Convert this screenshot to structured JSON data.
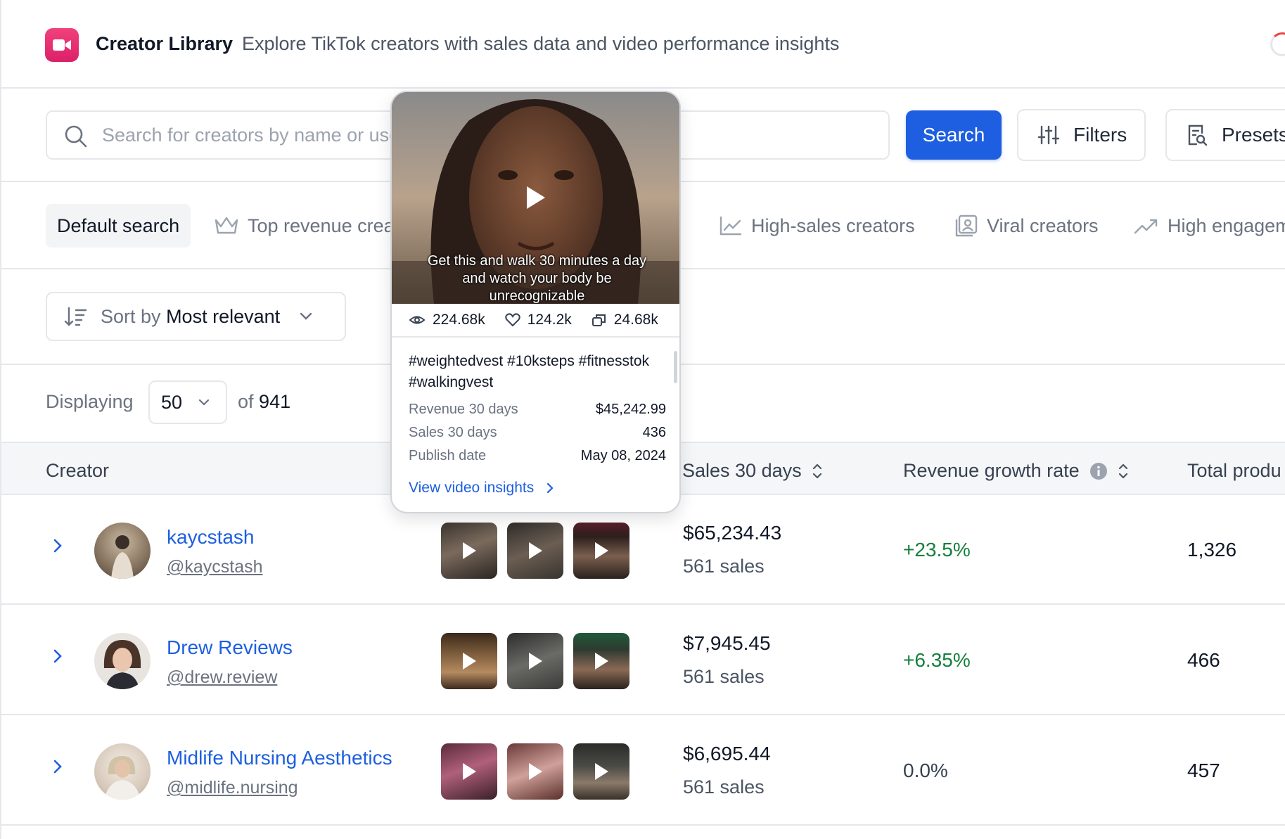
{
  "header": {
    "title": "Creator Library",
    "subtitle": "Explore TikTok creators with sales data and video performance insights"
  },
  "search": {
    "placeholder": "Search for creators by name or username",
    "button_label": "Search",
    "filters_label": "Filters",
    "presets_label": "Presets"
  },
  "preset_tabs": [
    {
      "label": "Default search",
      "icon": "none",
      "active": true
    },
    {
      "label": "Top revenue creators",
      "icon": "crown-icon"
    },
    {
      "label": "High-sales creators",
      "icon": "chart-line-icon"
    },
    {
      "label": "Viral creators",
      "icon": "viral-icon"
    },
    {
      "label": "High engagement",
      "icon": "trending-up-icon"
    }
  ],
  "sort": {
    "prefix": "Sort by",
    "value": "Most relevant"
  },
  "pagination": {
    "displaying_label": "Displaying",
    "page_size": "50",
    "of_label": "of",
    "total": "941"
  },
  "table": {
    "columns": {
      "creator": "Creator",
      "sales_30_days": "Sales 30 days",
      "revenue_growth_rate": "Revenue growth rate",
      "total_products": "Total produ"
    },
    "rows": [
      {
        "name": "kaycstash",
        "handle": "@kaycstash",
        "revenue": "$65,234.43",
        "sales": "561 sales",
        "growth": "+23.5%",
        "growth_color": "#15803d",
        "products": "1,326"
      },
      {
        "name": "Drew Reviews",
        "handle": "@drew.review",
        "revenue": "$7,945.45",
        "sales": "561 sales",
        "growth": "+6.35%",
        "growth_color": "#15803d",
        "products": "466"
      },
      {
        "name": "Midlife Nursing Aesthetics",
        "handle": "@midlife.nursing",
        "revenue": "$6,695.44",
        "sales": "561 sales",
        "growth": "0.0%",
        "growth_color": "#374151",
        "products": "457"
      }
    ]
  },
  "video_popup": {
    "caption": "Get this and walk 30 minutes a day and watch your body be unrecognizable",
    "views": "224.68k",
    "likes": "124.2k",
    "shares": "24.68k",
    "hashtags": "#weightedvest #10ksteps #fitnesstok #walkingvest",
    "revenue_label": "Revenue 30 days",
    "revenue_value": "$45,242.99",
    "sales_label": "Sales 30 days",
    "sales_value": "436",
    "publish_label": "Publish date",
    "publish_value": "May 08, 2024",
    "link_label": "View video insights"
  },
  "colors": {
    "accent": "#1d5fe0",
    "brand": "#e8306f",
    "positive": "#15803d"
  }
}
